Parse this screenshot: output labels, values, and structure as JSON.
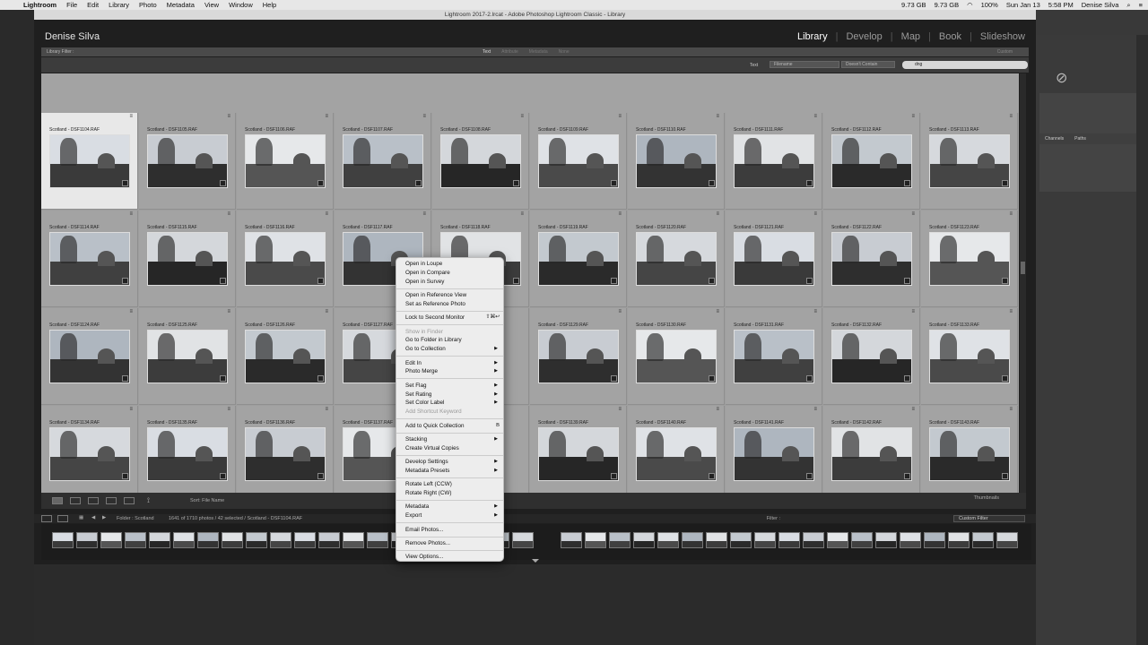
{
  "menubar": {
    "items": [
      "Lightroom",
      "File",
      "Edit",
      "Library",
      "Photo",
      "Metadata",
      "View",
      "Window",
      "Help"
    ],
    "status": [
      "9.73 GB",
      "9.73 GB",
      "100%",
      "Sun Jan 13",
      "5:58 PM",
      "Denise Silva"
    ]
  },
  "window": {
    "title": "Lightroom 2017-2.lrcat - Adobe Photoshop Lightroom Classic - Library"
  },
  "identity_plate": "Denise Silva",
  "modules": [
    "Library",
    "Develop",
    "Map",
    "Book",
    "Slideshow"
  ],
  "library_filter": {
    "label": "Library Filter :",
    "modes": [
      "Text",
      "Attribute",
      "Metadata",
      "None"
    ],
    "custom": "Custom"
  },
  "text_filter": {
    "label": "Text",
    "field": "Filename",
    "rule": "Doesn't Contain",
    "value": "dng"
  },
  "grid": {
    "rows": [
      [
        "Scotland - DSF1104.RAF",
        "Scotland - DSF1105.RAF",
        "Scotland - DSF1106.RAF",
        "Scotland - DSF1107.RAF",
        "Scotland - DSF1108.RAF",
        "Scotland - DSF1109.RAF",
        "Scotland - DSF1110.RAF",
        "Scotland - DSF1111.RAF",
        "Scotland - DSF1112.RAF",
        "Scotland - DSF1113.RAF"
      ],
      [
        "Scotland - DSF1114.RAF",
        "Scotland - DSF1115.RAF",
        "Scotland - DSF1116.RAF",
        "Scotland - DSF1117.RAF",
        "Scotland - DSF1118.RAF",
        "Scotland - DSF1119.RAF",
        "Scotland - DSF1120.RAF",
        "Scotland - DSF1121.RAF",
        "Scotland - DSF1122.RAF",
        "Scotland - DSF1123.RAF"
      ],
      [
        "Scotland - DSF1124.RAF",
        "Scotland - DSF1125.RAF",
        "Scotland - DSF1126.RAF",
        "Scotland - DSF1127.RAF",
        "",
        "Scotland - DSF1129.RAF",
        "Scotland - DSF1130.RAF",
        "Scotland - DSF1131.RAF",
        "Scotland - DSF1132.RAF",
        "Scotland - DSF1133.RAF"
      ],
      [
        "Scotland - DSF1134.RAF",
        "Scotland - DSF1135.RAF",
        "Scotland - DSF1136.RAF",
        "Scotland - DSF1137.RAF",
        "",
        "Scotland - DSF1139.RAF",
        "Scotland - DSF1140.RAF",
        "Scotland - DSF1141.RAF",
        "Scotland - DSF1142.RAF",
        "Scotland - DSF1143.RAF"
      ]
    ]
  },
  "toolbar": {
    "sort_label": "Sort:",
    "sort_value": "File Name",
    "thumbnails_label": "Thumbnails"
  },
  "filmstrip_nav": {
    "folder": "Folder : Scotland",
    "count": "1641 of 1710 photos / 42 selected / Scotland - DSF1104.RAF",
    "filter_label": "Filter :",
    "custom_filter": "Custom Filter"
  },
  "context_menu": {
    "groups": [
      [
        {
          "label": "Open in Loupe"
        },
        {
          "label": "Open in Compare"
        },
        {
          "label": "Open in Survey"
        }
      ],
      [
        {
          "label": "Open in Reference View"
        },
        {
          "label": "Set as Reference Photo"
        }
      ],
      [
        {
          "label": "Lock to Second Monitor",
          "shortcut": "⇧⌘↩"
        }
      ],
      [
        {
          "label": "Show in Finder",
          "disabled": true
        },
        {
          "label": "Go to Folder in Library"
        },
        {
          "label": "Go to Collection",
          "submenu": true
        }
      ],
      [
        {
          "label": "Edit In",
          "submenu": true
        },
        {
          "label": "Photo Merge",
          "submenu": true
        }
      ],
      [
        {
          "label": "Set Flag",
          "submenu": true
        },
        {
          "label": "Set Rating",
          "submenu": true
        },
        {
          "label": "Set Color Label",
          "submenu": true
        },
        {
          "label": "Add Shortcut Keyword",
          "disabled": true
        }
      ],
      [
        {
          "label": "Add to Quick Collection",
          "shortcut": "B"
        }
      ],
      [
        {
          "label": "Stacking",
          "submenu": true
        },
        {
          "label": "Create Virtual Copies"
        }
      ],
      [
        {
          "label": "Develop Settings",
          "submenu": true
        },
        {
          "label": "Metadata Presets",
          "submenu": true
        }
      ],
      [
        {
          "label": "Rotate Left (CCW)"
        },
        {
          "label": "Rotate Right (CW)"
        }
      ],
      [
        {
          "label": "Metadata",
          "submenu": true
        },
        {
          "label": "Export",
          "submenu": true
        }
      ],
      [
        {
          "label": "Email Photos..."
        }
      ],
      [
        {
          "label": "Remove Photos..."
        }
      ],
      [
        {
          "label": "View Options..."
        }
      ]
    ]
  },
  "photoshop_panel": {
    "tabs": [
      "Channels",
      "Paths"
    ]
  }
}
